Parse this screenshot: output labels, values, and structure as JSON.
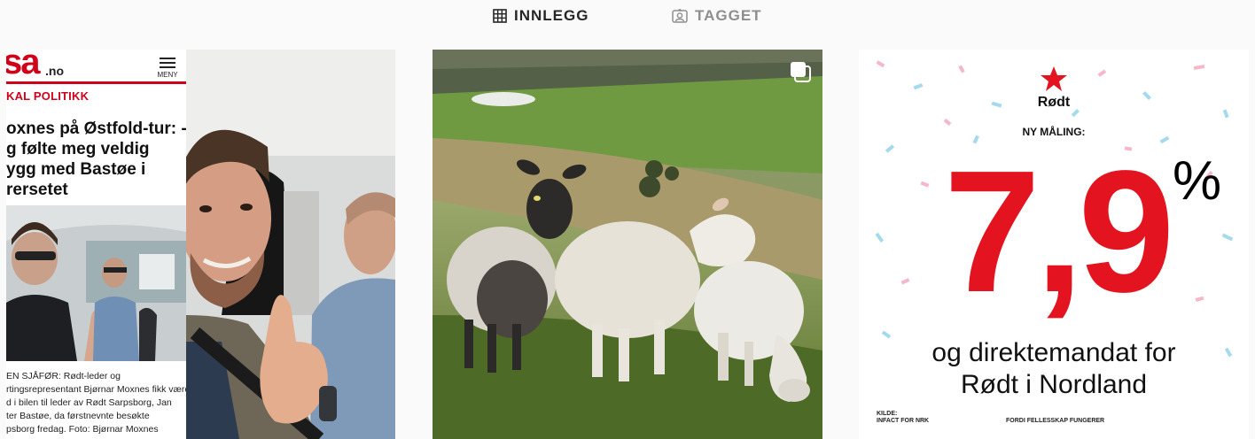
{
  "tabs": {
    "posts": {
      "label": "INNLEGG",
      "icon": "grid-icon",
      "active": true
    },
    "tagged": {
      "label": "TAGGET",
      "icon": "tagged-portrait-icon",
      "active": false
    }
  },
  "posts": [
    {
      "kind": "news-screenshot-and-selfie",
      "news": {
        "logo_text": "sa",
        "logo_tld": ".no",
        "menu_label": "MENY",
        "section": "KAL POLITIKK",
        "headline": "oxnes på Østfold-tur: -\ng følte meg veldig\nygg med Bastøe i\nrersetet",
        "caption": "EN SJÅFØR: Rødt-leder og\nrtingsrepresentant Bjørnar Moxnes fikk være\nd i bilen til leder av Rødt Sarpsborg, Jan\nter Bastøe, da førstnevnte besøkte\npsborg fredag. Foto: Bjørnar Moxnes"
      }
    },
    {
      "kind": "photo",
      "multiple_images": true,
      "multi_icon": "carousel-icon"
    },
    {
      "kind": "poll-graphic",
      "party": "Rødt",
      "label": "NY MÅLING:",
      "value": "7,9",
      "unit": "%",
      "description": "og direktemandat for\nRødt i Nordland",
      "source_label": "KILDE:",
      "source": "INFACT FOR NRK",
      "slogan": "FORDI FELLESSKAP FUNGERER"
    }
  ],
  "colors": {
    "background": "#fafafa",
    "tab_active": "#262626",
    "tab_inactive": "#8e8e8e",
    "party_red": "#e3131f",
    "news_red": "#d0021b"
  }
}
